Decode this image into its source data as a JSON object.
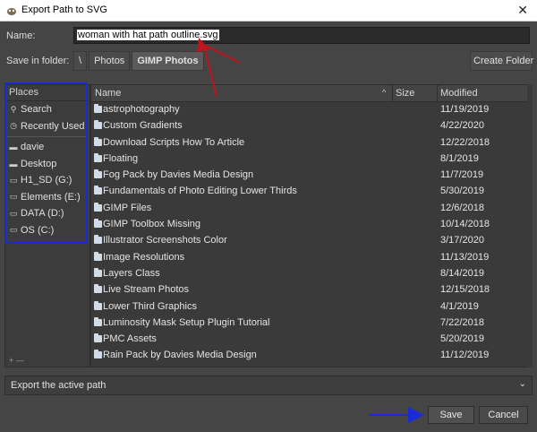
{
  "window": {
    "title": "Export Path to SVG",
    "close_glyph": "✕",
    "icon": "gimp-icon"
  },
  "name_field": {
    "label": "Name:",
    "value": "woman with hat path outline.svg"
  },
  "save_in": {
    "label": "Save in folder:",
    "crumbs": [
      "\\",
      "Photos",
      "GIMP Photos"
    ],
    "create_folder_label": "Create Folder"
  },
  "places": {
    "header": "Places",
    "items": [
      {
        "label": "Search",
        "icon": "search-icon"
      },
      {
        "label": "Recently Used",
        "icon": "clock-icon"
      },
      {
        "label": "davie",
        "icon": "home-folder-icon"
      },
      {
        "label": "Desktop",
        "icon": "desktop-folder-icon"
      },
      {
        "label": "H1_SD (G:)",
        "icon": "drive-icon"
      },
      {
        "label": "Elements (E:)",
        "icon": "drive-icon"
      },
      {
        "label": "DATA (D:)",
        "icon": "drive-icon"
      },
      {
        "label": "OS (C:)",
        "icon": "drive-icon"
      }
    ],
    "footer": "+ —"
  },
  "files": {
    "columns": {
      "name": "Name",
      "size": "Size",
      "modified": "Modified"
    },
    "sort_glyph": "^",
    "rows": [
      {
        "name": "astrophotography",
        "modified": "11/19/2019"
      },
      {
        "name": "Custom Gradients",
        "modified": "4/22/2020"
      },
      {
        "name": "Download Scripts How To Article",
        "modified": "12/22/2018"
      },
      {
        "name": "Floating",
        "modified": "8/1/2019"
      },
      {
        "name": "Fog Pack by Davies Media Design",
        "modified": "11/7/2019"
      },
      {
        "name": "Fundamentals of Photo Editing Lower Thirds",
        "modified": "5/30/2019"
      },
      {
        "name": "GIMP Files",
        "modified": "12/6/2018"
      },
      {
        "name": "GIMP Toolbox Missing",
        "modified": "10/14/2018"
      },
      {
        "name": "Illustrator Screenshots Color",
        "modified": "3/17/2020"
      },
      {
        "name": "Image Resolutions",
        "modified": "11/13/2019"
      },
      {
        "name": "Layers Class",
        "modified": "8/14/2019"
      },
      {
        "name": "Live Stream Photos",
        "modified": "12/15/2018"
      },
      {
        "name": "Lower Third Graphics",
        "modified": "4/1/2019"
      },
      {
        "name": "Luminosity Mask Setup Plugin Tutorial",
        "modified": "7/22/2018"
      },
      {
        "name": "PMC Assets",
        "modified": "5/20/2019"
      },
      {
        "name": "Rain Pack by Davies Media Design",
        "modified": "11/12/2019"
      }
    ]
  },
  "export_option": {
    "value": "Export the active path",
    "chevron": "⌄"
  },
  "buttons": {
    "save": "Save",
    "cancel": "Cancel"
  },
  "colors": {
    "annotation_red": "#c0141c",
    "annotation_blue": "#1a2ad6",
    "dialog_bg": "#454545"
  }
}
